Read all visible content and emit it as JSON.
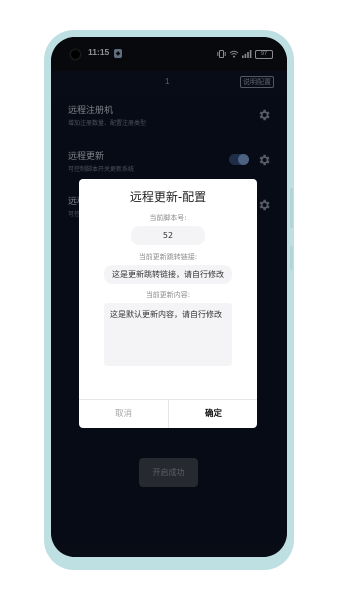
{
  "status_bar": {
    "time": "11:15",
    "notification_icon": "app-notification-icon",
    "icons": [
      "vibrate-icon",
      "wifi-icon",
      "signal-icon"
    ],
    "battery": "97"
  },
  "top_bar": {
    "number": "1",
    "button_label": "说明配置"
  },
  "list": {
    "items": [
      {
        "title": "远程注册机",
        "subtitle": "增加注册数量、配置注册类型"
      },
      {
        "title": "远程更新",
        "subtitle": "可控制脚本开关更新系统"
      },
      {
        "title": "远程",
        "subtitle": "可控"
      }
    ]
  },
  "dialog": {
    "title": "远程更新-配置",
    "version_label": "当前脚本号:",
    "version_value": "52",
    "link_label": "当前更新跳转链接:",
    "link_value": "这是更新跳转链接，请自行修改",
    "content_label": "当前更新内容:",
    "content_value": "这是默认更新内容，请自行修改",
    "cancel_label": "取消",
    "ok_label": "确定"
  },
  "success_button": "开启成功",
  "colors": {
    "screen_bg": "#0b1324",
    "toggle_on": "#7fa3d6",
    "dialog_bg": "#ffffff",
    "frame": "#bfe0e2"
  }
}
